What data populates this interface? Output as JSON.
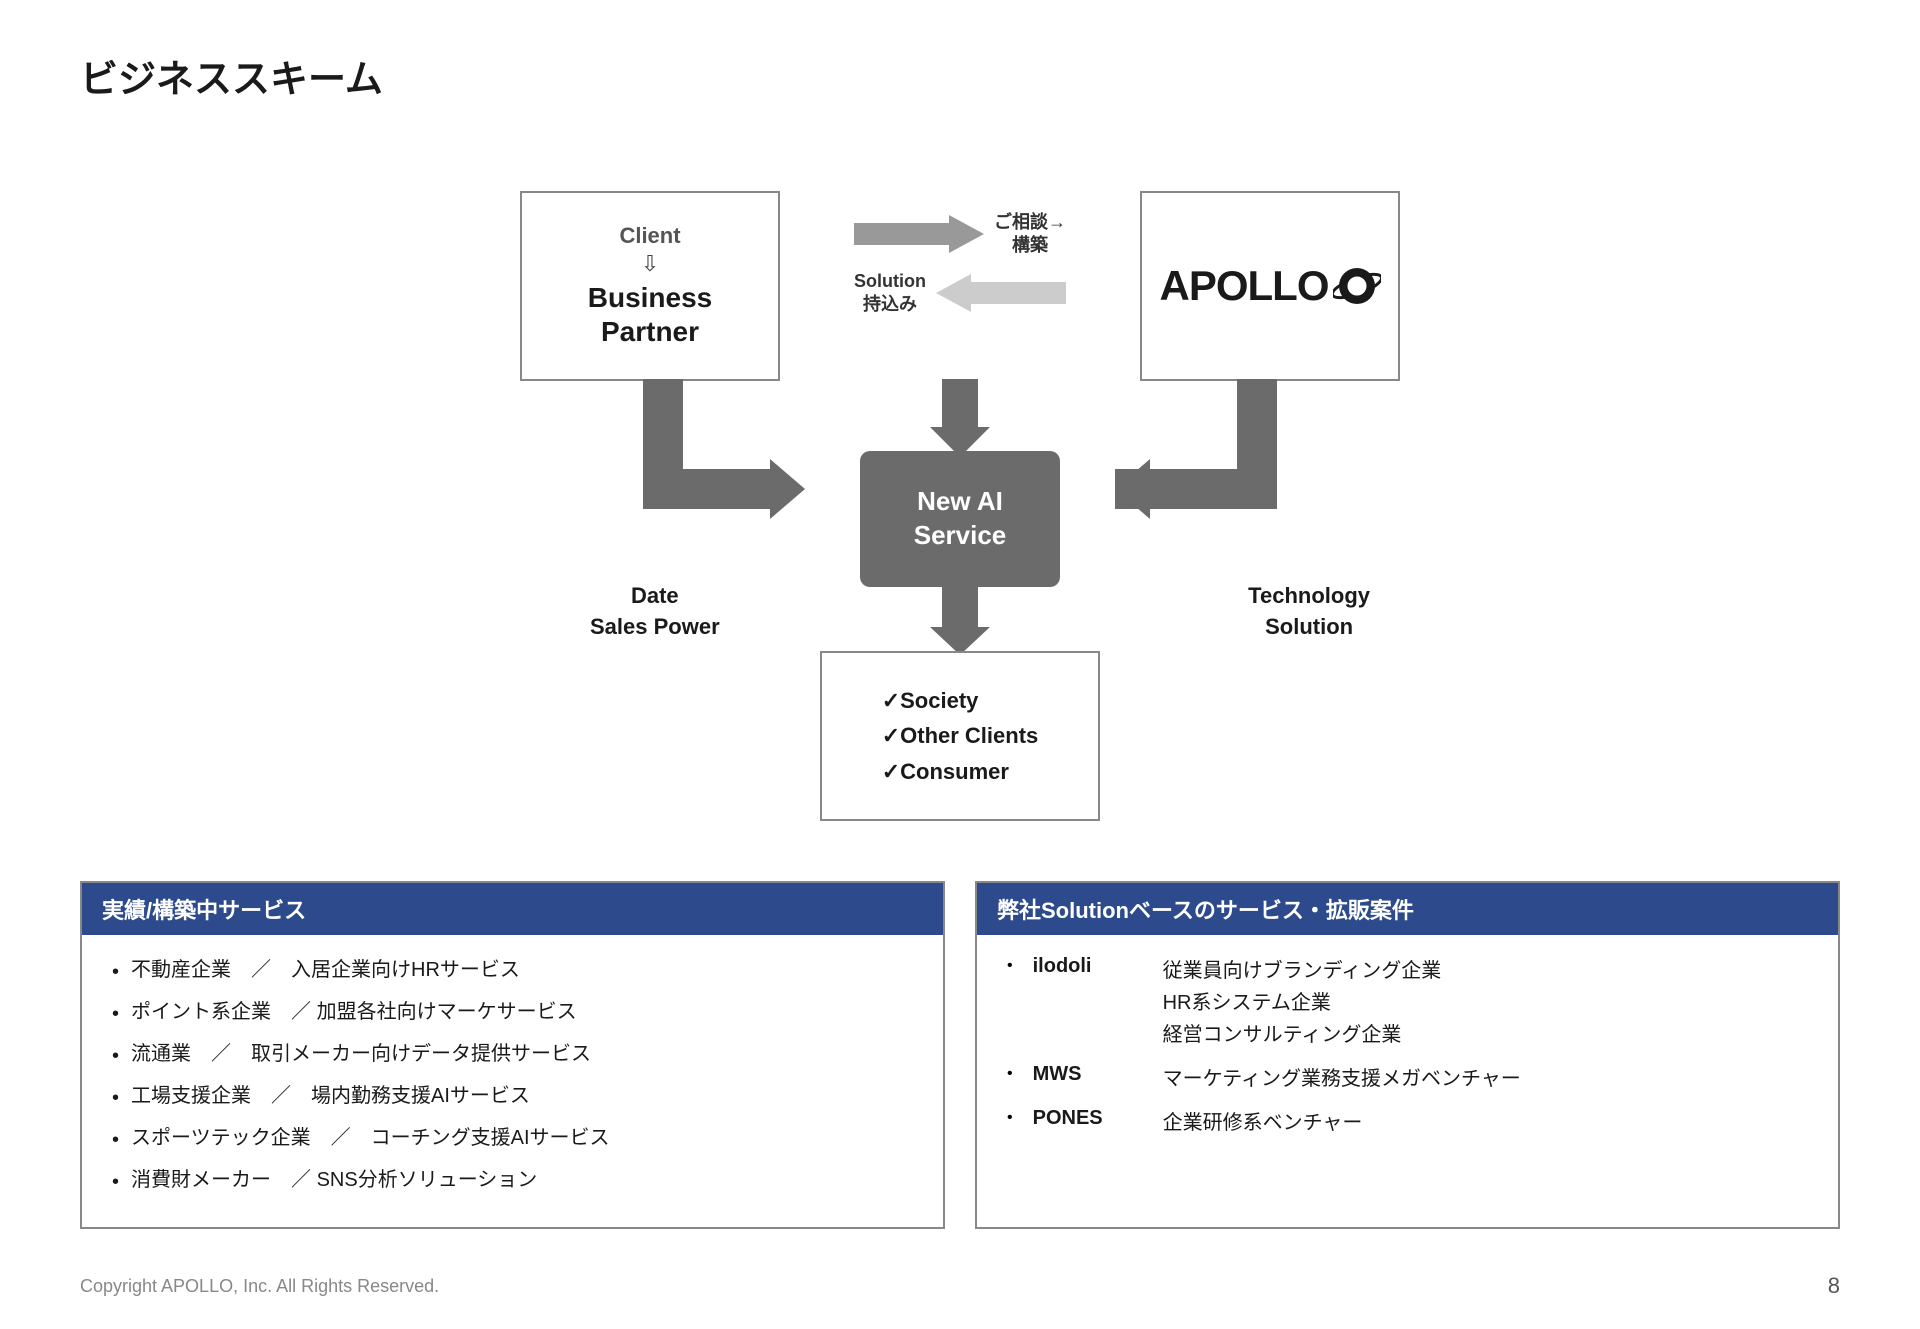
{
  "page": {
    "title": "ビジネススキーム",
    "footer_copyright": "Copyright APOLLO, Inc. All Rights Reserved.",
    "footer_page": "8"
  },
  "diagram": {
    "client_box": {
      "label1": "Client",
      "arrow": "⇩",
      "label2": "Business",
      "label3": "Partner"
    },
    "apollo_box": {
      "text": "APOLLO"
    },
    "top_arrow_right": {
      "text1": "ご相談→",
      "text2": "構築"
    },
    "top_arrow_left": {
      "text1": "Solution",
      "text2": "持込み"
    },
    "new_ai_box": {
      "line1": "New AI",
      "line2": "Service"
    },
    "label_left": {
      "line1": "Date",
      "line2": "Sales Power"
    },
    "label_right": {
      "line1": "Technology",
      "line2": "Solution"
    },
    "society_box": {
      "item1": "✓Society",
      "item2": "✓Other Clients",
      "item3": "✓Consumer"
    }
  },
  "bottom": {
    "left_table": {
      "header": "実績/構築中サービス",
      "items": [
        "不動産企業　／　入居企業向けHRサービス",
        "ポイント系企業　／ 加盟各社向けマーケサービス",
        "流通業　／　取引メーカー向けデータ提供サービス",
        "工場支援企業　／　場内勤務支援AIサービス",
        "スポーツテック企業　／　コーチング支援AIサービス",
        "消費財メーカー　／ SNS分析ソリューション"
      ]
    },
    "right_table": {
      "header": "弊社Solutionベースのサービス・拡販案件",
      "rows": [
        {
          "name": "ilodoli",
          "desc": "従業員向けブランディング企業\nHR系システム企業\n経営コンサルティング企業"
        },
        {
          "name": "MWS",
          "desc": "マーケティング業務支援メガベンチャー"
        },
        {
          "name": "PONES",
          "desc": "企業研修系ベンチャー"
        }
      ]
    }
  }
}
